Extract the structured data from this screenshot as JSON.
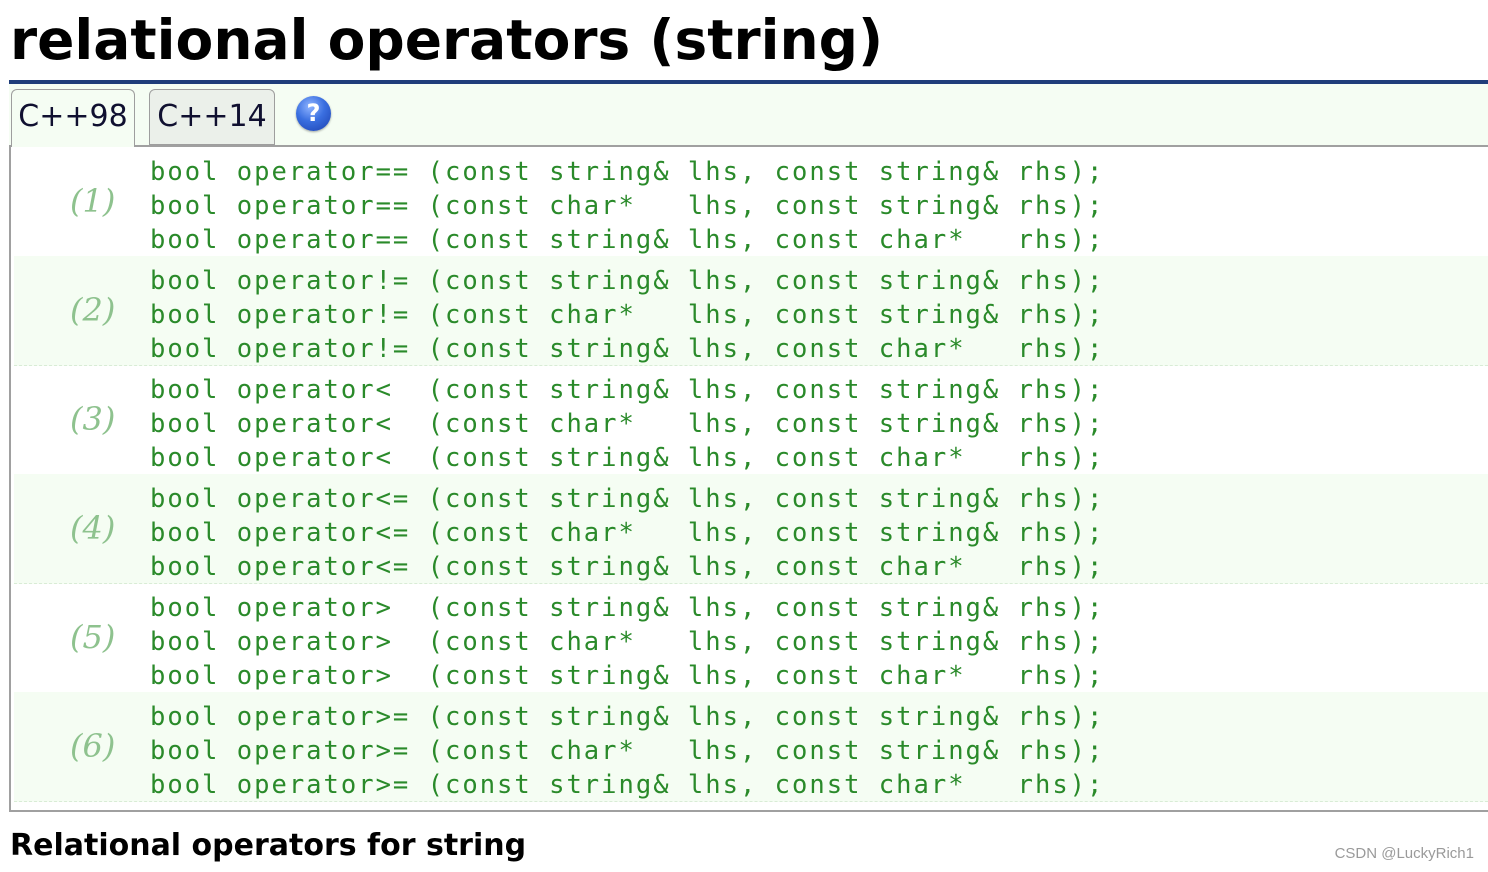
{
  "title": "relational operators (string)",
  "tabs": [
    {
      "label": "C++98",
      "active": true
    },
    {
      "label": "C++14",
      "active": false
    }
  ],
  "help_icon": {
    "name": "help-icon",
    "glyph": "?"
  },
  "groups": [
    {
      "number": "(1)",
      "lines": [
        "bool operator== (const string& lhs, const string& rhs);",
        "bool operator== (const char*   lhs, const string& rhs);",
        "bool operator== (const string& lhs, const char*   rhs);"
      ]
    },
    {
      "number": "(2)",
      "lines": [
        "bool operator!= (const string& lhs, const string& rhs);",
        "bool operator!= (const char*   lhs, const string& rhs);",
        "bool operator!= (const string& lhs, const char*   rhs);"
      ]
    },
    {
      "number": "(3)",
      "lines": [
        "bool operator<  (const string& lhs, const string& rhs);",
        "bool operator<  (const char*   lhs, const string& rhs);",
        "bool operator<  (const string& lhs, const char*   rhs);"
      ]
    },
    {
      "number": "(4)",
      "lines": [
        "bool operator<= (const string& lhs, const string& rhs);",
        "bool operator<= (const char*   lhs, const string& rhs);",
        "bool operator<= (const string& lhs, const char*   rhs);"
      ]
    },
    {
      "number": "(5)",
      "lines": [
        "bool operator>  (const string& lhs, const string& rhs);",
        "bool operator>  (const char*   lhs, const string& rhs);",
        "bool operator>  (const string& lhs, const char*   rhs);"
      ]
    },
    {
      "number": "(6)",
      "lines": [
        "bool operator>= (const string& lhs, const string& rhs);",
        "bool operator>= (const char*   lhs, const string& rhs);",
        "bool operator>= (const string& lhs, const char*   rhs);"
      ]
    }
  ],
  "section_heading": "Relational operators for string",
  "watermark": "CSDN @LuckyRich1",
  "colors": {
    "title_rule": "#1f3d7a",
    "code_text": "#2a8a2a",
    "group_number": "#8ec28e",
    "alt_row_bg": "#f5fdf3"
  }
}
